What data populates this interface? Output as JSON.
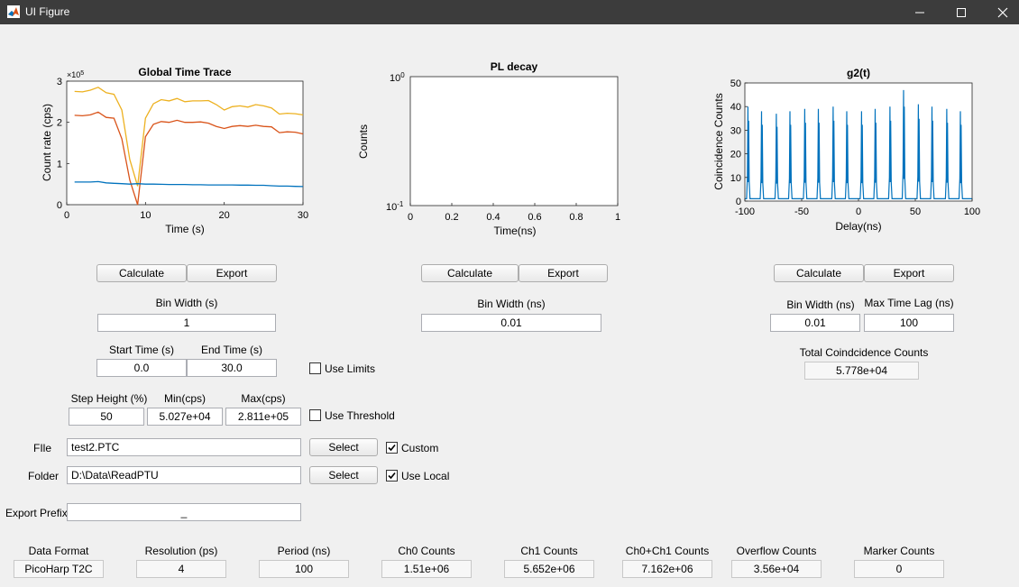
{
  "window": {
    "title": "UI Figure"
  },
  "colors": {
    "series1": "#0072bd",
    "series2": "#d95319",
    "series3": "#edb120",
    "titlebar": "#3c3c3c"
  },
  "plots": {
    "trace": {
      "title": "Global Time Trace",
      "xlabel": "Time (s)",
      "ylabel": "Count rate (cps)",
      "exponent": "×10",
      "exponent_power": "5",
      "xticks": [
        "0",
        "10",
        "20",
        "30"
      ],
      "yticks": [
        "0",
        "1",
        "2",
        "3"
      ]
    },
    "pl": {
      "title": "PL decay",
      "xlabel": "Time(ns)",
      "ylabel": "Counts",
      "xticks": [
        "0",
        "0.2",
        "0.4",
        "0.6",
        "0.8",
        "1"
      ],
      "ytop_base": "10",
      "ytop_pow": "0",
      "ybot_base": "10",
      "ybot_pow": "-1"
    },
    "g2": {
      "title": "g2(t)",
      "xlabel": "Delay(ns)",
      "ylabel": "Coincidence Counts",
      "xticks": [
        "-100",
        "-50",
        "0",
        "50",
        "100"
      ],
      "yticks": [
        "0",
        "10",
        "20",
        "30",
        "40",
        "50"
      ]
    }
  },
  "chart_data": [
    {
      "type": "line",
      "title": "Global Time Trace",
      "xlabel": "Time (s)",
      "ylabel": "Count rate (cps)",
      "xlim": [
        0,
        30
      ],
      "ylim": [
        0,
        300000
      ],
      "x": [
        1,
        2,
        3,
        4,
        5,
        6,
        7,
        8,
        9,
        10,
        11,
        12,
        13,
        14,
        15,
        16,
        17,
        18,
        19,
        20,
        21,
        22,
        23,
        24,
        25,
        26,
        27,
        28,
        29,
        30
      ],
      "series": [
        {
          "color": "#edb120",
          "values": [
            275000,
            274000,
            278000,
            285000,
            272000,
            268000,
            230000,
            110000,
            45000,
            210000,
            245000,
            255000,
            252000,
            258000,
            250000,
            252000,
            252000,
            253000,
            243000,
            230000,
            238000,
            240000,
            237000,
            243000,
            240000,
            235000,
            220000,
            222000,
            221000,
            218000
          ]
        },
        {
          "color": "#d95319",
          "values": [
            217000,
            216000,
            218000,
            225000,
            212000,
            210000,
            160000,
            60000,
            0,
            165000,
            195000,
            202000,
            200000,
            205000,
            200000,
            200000,
            201000,
            198000,
            190000,
            185000,
            190000,
            192000,
            190000,
            193000,
            190000,
            189000,
            175000,
            177000,
            176000,
            172000
          ]
        },
        {
          "color": "#0072bd",
          "values": [
            55000,
            55000,
            55000,
            56000,
            53000,
            52000,
            51000,
            50000,
            51000,
            50000,
            50000,
            49500,
            49000,
            49000,
            49000,
            48500,
            48500,
            48000,
            48000,
            48000,
            48000,
            47500,
            47500,
            47000,
            47000,
            46000,
            45000,
            45000,
            44500,
            44000
          ]
        }
      ]
    },
    {
      "type": "line",
      "title": "PL decay",
      "xlabel": "Time(ns)",
      "ylabel": "Counts",
      "xlim": [
        0,
        1
      ],
      "ylim": [
        0.1,
        1
      ],
      "yscale": "log",
      "series": []
    },
    {
      "type": "line",
      "title": "g2(t)",
      "xlabel": "Delay(ns)",
      "ylabel": "Coincidence Counts",
      "xlim": [
        -100,
        100
      ],
      "ylim": [
        0,
        50
      ],
      "peaks_x": [
        -97,
        -85,
        -72,
        -60,
        -47,
        -35,
        -22,
        -10,
        3,
        15,
        28,
        40,
        53,
        65,
        78,
        90
      ],
      "peaks_y": [
        40,
        38,
        37,
        38,
        39,
        39,
        40,
        38,
        38,
        39,
        40,
        47,
        41,
        40,
        39,
        38
      ],
      "baseline": 1,
      "color": "#0072bd"
    }
  ],
  "trace_controls": {
    "calculate": "Calculate",
    "export": "Export",
    "bin_width_label": "Bin Width (s)",
    "bin_width": "1",
    "start_label": "Start Time (s)",
    "start": "0.0",
    "end_label": "End Time (s)",
    "end": "30.0",
    "use_limits": "Use Limits",
    "step_label": "Step Height (%)",
    "step": "50",
    "min_label": "Min(cps)",
    "min": "5.027e+04",
    "max_label": "Max(cps)",
    "max": "2.811e+05",
    "use_threshold": "Use Threshold"
  },
  "pl_controls": {
    "calculate": "Calculate",
    "export": "Export",
    "bin_width_label": "Bin Width (ns)",
    "bin_width": "0.01"
  },
  "g2_controls": {
    "calculate": "Calculate",
    "export": "Export",
    "bin_width_label": "Bin Width (ns)",
    "bin_width": "0.01",
    "max_lag_label": "Max Time Lag (ns)",
    "max_lag": "100",
    "total_label": "Total Coindcidence Counts",
    "total": "5.778e+04"
  },
  "file": {
    "file_label": "FIle",
    "file_value": "test2.PTC",
    "select": "Select",
    "custom": "Custom",
    "custom_checked": true,
    "folder_label": "Folder",
    "folder_value": "D:\\Data\\ReadPTU",
    "use_local": "Use Local",
    "use_local_checked": true,
    "export_prefix_label": "Export Prefix",
    "export_prefix_value": "_"
  },
  "stats": [
    {
      "label": "Data Format",
      "value": "PicoHarp T2C"
    },
    {
      "label": "Resolution (ps)",
      "value": "4"
    },
    {
      "label": "Period (ns)",
      "value": "100"
    },
    {
      "label": "Ch0 Counts",
      "value": "1.51e+06"
    },
    {
      "label": "Ch1 Counts",
      "value": "5.652e+06"
    },
    {
      "label": "Ch0+Ch1 Counts",
      "value": "7.162e+06"
    },
    {
      "label": "Overflow Counts",
      "value": "3.56e+04"
    },
    {
      "label": "Marker Counts",
      "value": "0"
    }
  ]
}
